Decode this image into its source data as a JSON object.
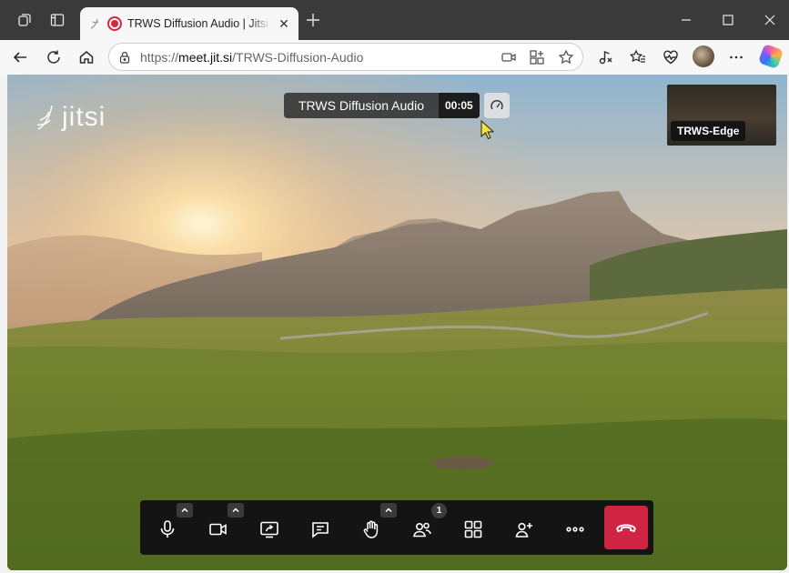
{
  "browser": {
    "tab_title": "TRWS Diffusion Audio | Jitsi Meet",
    "url_protocol": "https://",
    "url_host": "meet.jit.si",
    "url_path": "/TRWS-Diffusion-Audio"
  },
  "meeting": {
    "logo_text": "jitsi",
    "title": "TRWS Diffusion Audio",
    "elapsed": "00:05",
    "participant_tile_name": "TRWS-Edge",
    "participant_count": "1"
  },
  "colors": {
    "hangup": "#cf2542",
    "toolbar_bg": "#141414",
    "recording_dot": "#d7263d"
  }
}
